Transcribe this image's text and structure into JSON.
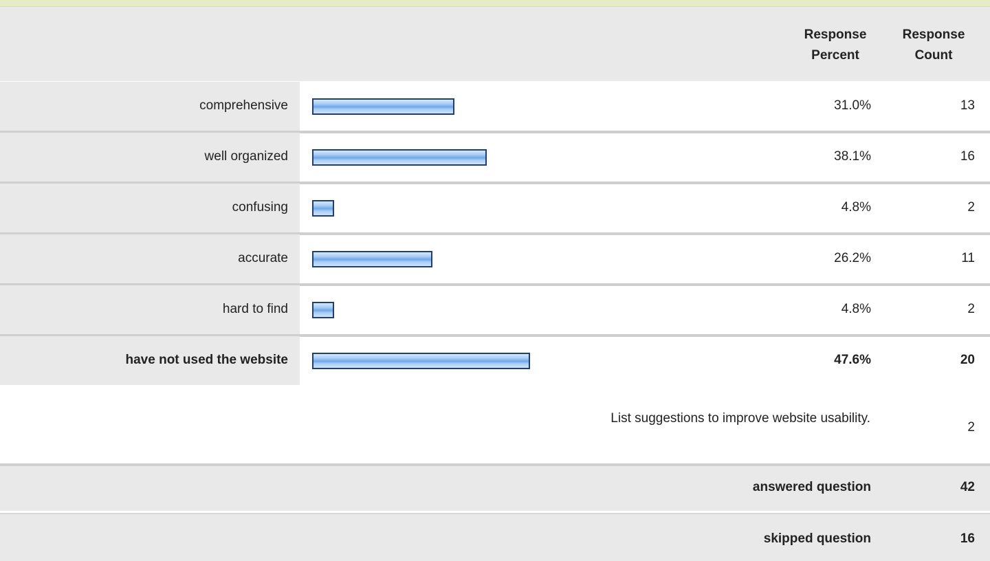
{
  "header": {
    "response_percent": "Response Percent",
    "response_count": "Response Count"
  },
  "chart_data": {
    "type": "bar",
    "orientation": "horizontal",
    "categories": [
      "comprehensive",
      "well organized",
      "confusing",
      "accurate",
      "hard to find",
      "have not used the website"
    ],
    "values": [
      31.0,
      38.1,
      4.8,
      26.2,
      4.8,
      47.6
    ],
    "counts": [
      13,
      16,
      2,
      11,
      2,
      20
    ],
    "percent_labels": [
      "31.0%",
      "38.1%",
      "4.8%",
      "26.2%",
      "4.8%",
      "47.6%"
    ],
    "count_labels": [
      "13",
      "16",
      "2",
      "11",
      "2",
      "20"
    ],
    "xlim": [
      0,
      100
    ],
    "colors": {
      "bar_fill": "#a9cdf4",
      "bar_border": "#1f3f6e"
    }
  },
  "suggestions": {
    "text": "List suggestions to improve website usability.",
    "count": "2"
  },
  "footer": {
    "answered_label": "answered question",
    "answered_value": "42",
    "skipped_label": "skipped question",
    "skipped_value": "16"
  }
}
